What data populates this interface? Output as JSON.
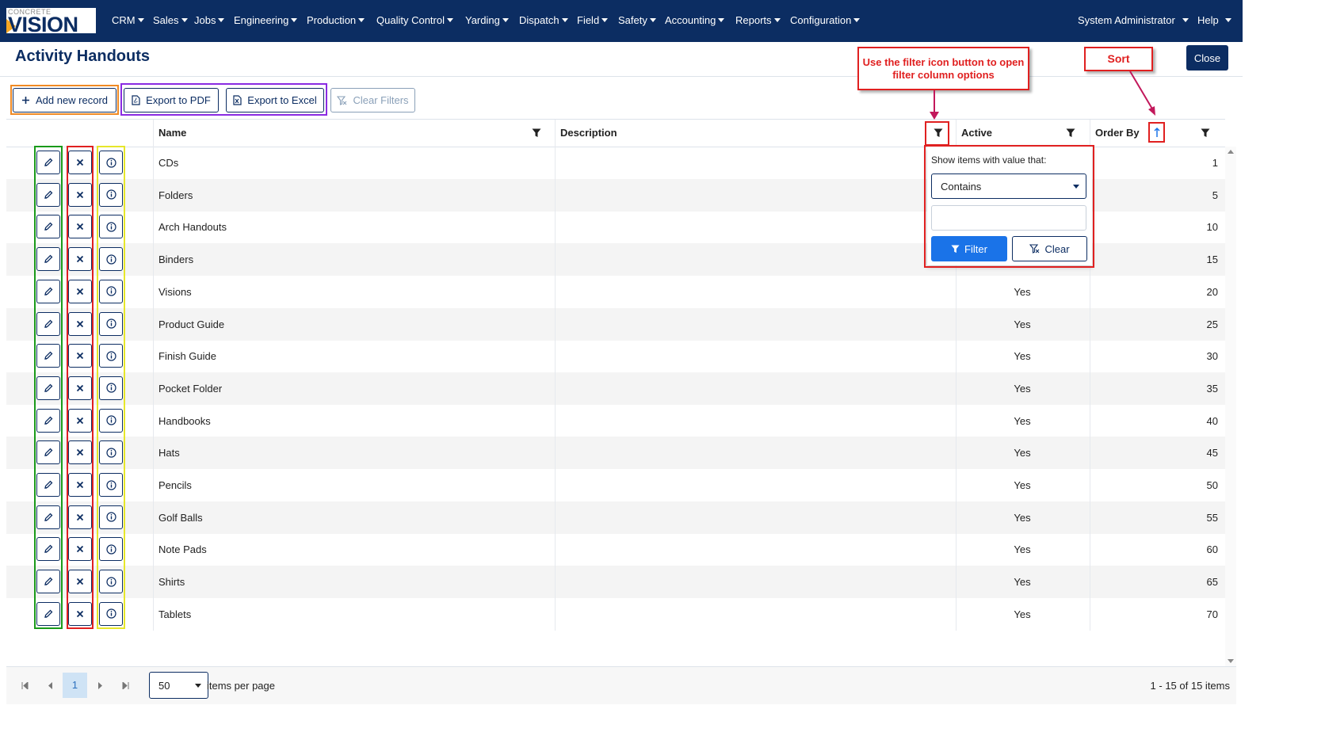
{
  "app": {
    "logo_small": "CONCRETE",
    "logo_big": "VISION",
    "menu": [
      "CRM",
      "Sales",
      "Jobs",
      "Engineering",
      "Production",
      "Quality Control",
      "Yarding",
      "Dispatch",
      "Field",
      "Safety",
      "Accounting",
      "Reports",
      "Configuration"
    ],
    "user": "System Administrator",
    "help": "Help"
  },
  "page": {
    "title": "Activity Handouts",
    "close_label": "Close"
  },
  "toolbar": {
    "add_label": "Add new record",
    "pdf_label": "Export to PDF",
    "excel_label": "Export to Excel",
    "clear_label": "Clear Filters"
  },
  "grid": {
    "columns": {
      "name": "Name",
      "description": "Description",
      "active": "Active",
      "order": "Order By"
    },
    "rows": [
      {
        "name": "CDs",
        "description": "",
        "active": "",
        "order": "1"
      },
      {
        "name": "Folders",
        "description": "",
        "active": "",
        "order": "5"
      },
      {
        "name": "Arch Handouts",
        "description": "",
        "active": "",
        "order": "10"
      },
      {
        "name": "Binders",
        "description": "",
        "active": "",
        "order": "15"
      },
      {
        "name": "Visions",
        "description": "",
        "active": "Yes",
        "order": "20"
      },
      {
        "name": "Product Guide",
        "description": "",
        "active": "Yes",
        "order": "25"
      },
      {
        "name": "Finish Guide",
        "description": "",
        "active": "Yes",
        "order": "30"
      },
      {
        "name": "Pocket Folder",
        "description": "",
        "active": "Yes",
        "order": "35"
      },
      {
        "name": "Handbooks",
        "description": "",
        "active": "Yes",
        "order": "40"
      },
      {
        "name": "Hats",
        "description": "",
        "active": "Yes",
        "order": "45"
      },
      {
        "name": "Pencils",
        "description": "",
        "active": "Yes",
        "order": "50"
      },
      {
        "name": "Golf Balls",
        "description": "",
        "active": "Yes",
        "order": "55"
      },
      {
        "name": "Note Pads",
        "description": "",
        "active": "Yes",
        "order": "60"
      },
      {
        "name": "Shirts",
        "description": "",
        "active": "Yes",
        "order": "65"
      },
      {
        "name": "Tablets",
        "description": "",
        "active": "Yes",
        "order": "70"
      }
    ]
  },
  "filter_popup": {
    "label": "Show items with value that:",
    "operator": "Contains",
    "value": "",
    "filter_label": "Filter",
    "clear_label": "Clear"
  },
  "pager": {
    "current_page": "1",
    "page_size": "50",
    "items_per_page_label": "items per page",
    "range_label": "1 - 15 of 15 items"
  },
  "annotations": {
    "filter_note": "Use the filter icon button to open filter column options",
    "sort_note": "Sort"
  },
  "icons": {
    "add": "plus-icon",
    "pdf": "pdf-file-icon",
    "excel": "excel-file-icon",
    "clear": "clear-filter-icon",
    "filter": "filter-icon",
    "sort": "sort-asc-icon",
    "edit": "pencil-icon",
    "delete": "x-icon",
    "info": "info-icon"
  },
  "colors": {
    "nav": "#0c2d62",
    "primary": "#1a73e8",
    "annotation": "#e02020",
    "highlight_add": "#f08a24",
    "highlight_export": "#8a2be2",
    "highlight_edit": "#1a9a1a",
    "highlight_delete": "#e02020",
    "highlight_info": "#e6e62a"
  }
}
